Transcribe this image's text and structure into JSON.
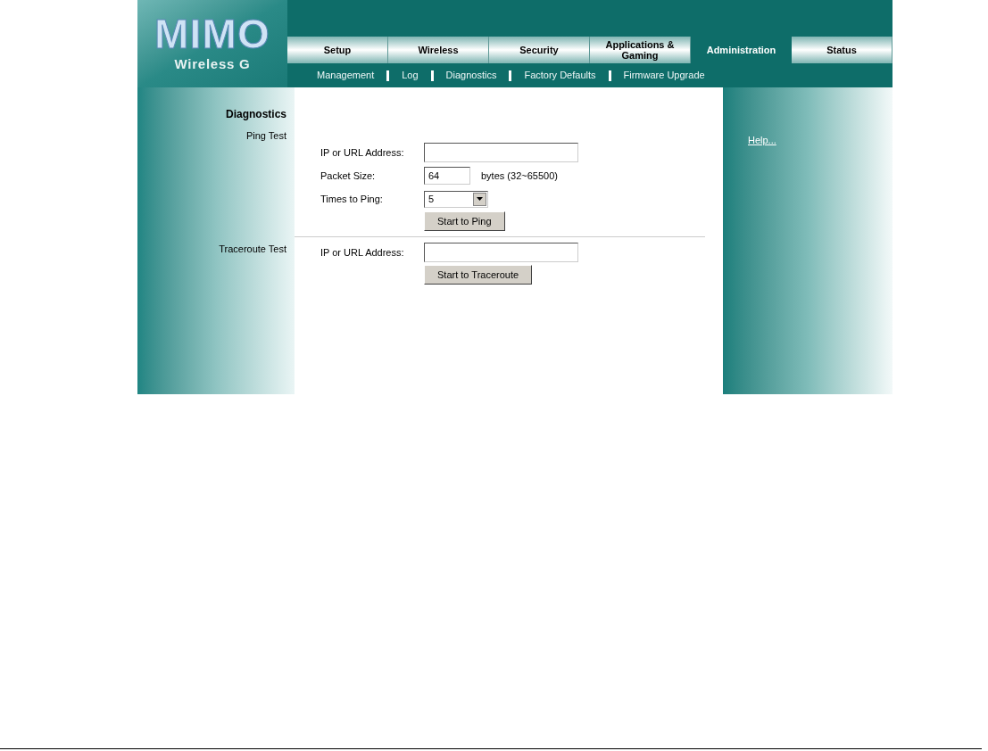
{
  "logo": {
    "title": "MIMO",
    "subtitle": "Wireless G"
  },
  "tabs": [
    {
      "label": "Setup",
      "selected": false
    },
    {
      "label": "Wireless",
      "selected": false
    },
    {
      "label": "Security",
      "selected": false
    },
    {
      "label": "Applications & Gaming",
      "selected": false
    },
    {
      "label": "Administration",
      "selected": true
    },
    {
      "label": "Status",
      "selected": false
    }
  ],
  "subnav": [
    {
      "label": "Management"
    },
    {
      "label": "Log"
    },
    {
      "label": "Diagnostics"
    },
    {
      "label": "Factory Defaults"
    },
    {
      "label": "Firmware Upgrade"
    }
  ],
  "sidebar": {
    "title": "Diagnostics"
  },
  "sections": [
    {
      "label": "Ping Test",
      "fields": [
        {
          "kind": "text",
          "label": "IP or URL Address:"
        },
        {
          "kind": "small",
          "label": "Packet Size:",
          "value": "64",
          "suffix": "bytes (32~65500)"
        },
        {
          "kind": "select",
          "label": "Times to Ping:",
          "value": "5"
        }
      ],
      "button": "Start to Ping"
    },
    {
      "label": "Traceroute Test",
      "fields": [
        {
          "kind": "text",
          "label": "IP or URL Address:"
        }
      ],
      "button": "Start to Traceroute"
    }
  ],
  "help": {
    "link": "Help..."
  }
}
